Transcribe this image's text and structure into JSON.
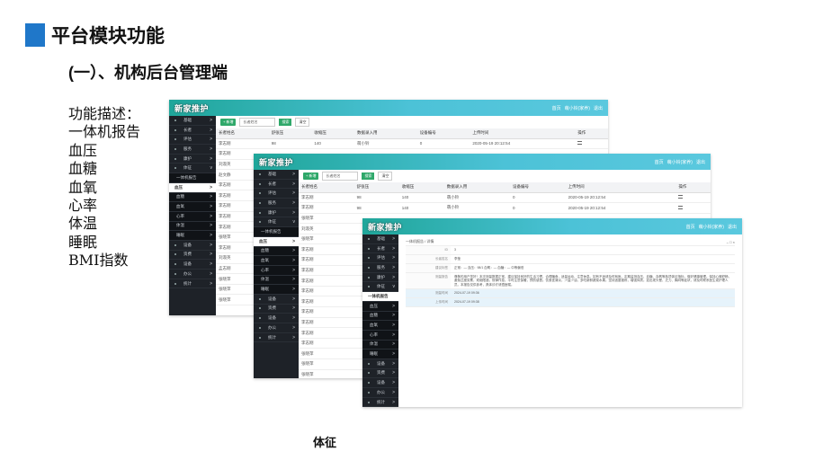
{
  "slide": {
    "title": "平台模块功能",
    "subtitle": "(一）、机构后台管理端",
    "desc_heading": "功能描述：",
    "desc_items": [
      "一体机报告",
      "血压",
      "血糖",
      "血氧",
      "心率",
      "体温",
      "睡眠",
      "BMI指数"
    ],
    "caption": "体征"
  },
  "app": {
    "brand": "新家推护",
    "top_right": [
      "首页",
      "萌小铃(家养)",
      "退出"
    ],
    "add_label": "+ 新增",
    "select_placeholder": "长者姓名",
    "search_label": "搜索",
    "clear_label": "清空",
    "columns": [
      "长者姓名",
      "舒张压",
      "收缩压",
      "数据录入用",
      "设备编号",
      "上传时间",
      "操作"
    ]
  },
  "win1": {
    "sidebar": [
      {
        "label": "基础",
        "arrow": ">"
      },
      {
        "label": "长者",
        "arrow": ">"
      },
      {
        "label": "评估",
        "arrow": ">"
      },
      {
        "label": "服务",
        "arrow": ">"
      },
      {
        "label": "康护",
        "arrow": ">"
      },
      {
        "label": "体征",
        "arrow": "v"
      },
      {
        "label": "一体机报告",
        "arrow": "",
        "sub": true
      },
      {
        "label": "血压",
        "arrow": ">",
        "light": true
      },
      {
        "label": "血糖",
        "arrow": ">",
        "sub": true
      },
      {
        "label": "血氧",
        "arrow": ">",
        "sub": true
      },
      {
        "label": "心率",
        "arrow": ">",
        "sub": true
      },
      {
        "label": "体温",
        "arrow": ">",
        "sub": true
      },
      {
        "label": "睡眠",
        "arrow": ">",
        "sub": true
      },
      {
        "label": "设备",
        "arrow": ">"
      },
      {
        "label": "资费",
        "arrow": ">"
      },
      {
        "label": "设备",
        "arrow": ">"
      },
      {
        "label": "办公",
        "arrow": ">"
      },
      {
        "label": "统计",
        "arrow": ">"
      }
    ],
    "rows": [
      [
        "李志刚",
        "98",
        "140",
        "萌小铃",
        "0",
        "2020-05-19 20:12:54",
        "icon"
      ],
      [
        "李志刚",
        "",
        "",
        "",
        "",
        "",
        ""
      ],
      [
        "刘淑英",
        "",
        "",
        "",
        "",
        "",
        ""
      ],
      [
        "赵文静",
        "",
        "",
        "",
        "",
        "",
        ""
      ],
      [
        "李志刚",
        "",
        "",
        "",
        "",
        "",
        ""
      ],
      [
        "李志刚",
        "",
        "",
        "",
        "",
        "",
        ""
      ],
      [
        "李志刚",
        "",
        "",
        "",
        "",
        "",
        ""
      ],
      [
        "李志刚",
        "",
        "",
        "",
        "",
        "",
        ""
      ],
      [
        "李志刚",
        "",
        "",
        "",
        "",
        "",
        ""
      ],
      [
        "张晓萍",
        "",
        "",
        "",
        "",
        "",
        ""
      ],
      [
        "李志刚",
        "",
        "",
        "",
        "",
        "",
        ""
      ],
      [
        "刘淑英",
        "",
        "",
        "",
        "",
        "",
        ""
      ],
      [
        "孟志刚",
        "",
        "",
        "",
        "",
        "",
        ""
      ],
      [
        "张晓萍",
        "",
        "",
        "",
        "",
        "",
        ""
      ],
      [
        "张晓萍",
        "",
        "",
        "",
        "",
        "",
        ""
      ],
      [
        "张晓萍",
        "",
        "",
        "",
        "",
        "",
        ""
      ]
    ]
  },
  "win2": {
    "sidebar": [
      {
        "label": "基础",
        "arrow": ">"
      },
      {
        "label": "长者",
        "arrow": ">"
      },
      {
        "label": "评估",
        "arrow": ">"
      },
      {
        "label": "服务",
        "arrow": ">"
      },
      {
        "label": "康护",
        "arrow": ">"
      },
      {
        "label": "体征",
        "arrow": "v"
      },
      {
        "label": "一体机报告",
        "arrow": "",
        "sub": true
      },
      {
        "label": "血压",
        "arrow": ">",
        "light": true
      },
      {
        "label": "血糖",
        "arrow": ">",
        "sub": true
      },
      {
        "label": "血氧",
        "arrow": ">",
        "sub": true
      },
      {
        "label": "心率",
        "arrow": ">",
        "sub": true
      },
      {
        "label": "体温",
        "arrow": ">",
        "sub": true
      },
      {
        "label": "睡眠",
        "arrow": ">",
        "sub": true
      },
      {
        "label": "设备",
        "arrow": ">"
      },
      {
        "label": "资费",
        "arrow": ">"
      },
      {
        "label": "设备",
        "arrow": ">"
      },
      {
        "label": "办公",
        "arrow": ">"
      },
      {
        "label": "统计",
        "arrow": ">"
      }
    ],
    "rows": [
      [
        "李志刚",
        "98",
        "140",
        "萌小铃",
        "0",
        "2020-05-19 20:12:54",
        "icon"
      ],
      [
        "李志刚",
        "98",
        "140",
        "萌小铃",
        "0",
        "2020-05-19 20:12:54",
        "icon"
      ],
      [
        "张晓萍",
        "",
        "",
        "",
        "",
        "",
        ""
      ],
      [
        "刘淑英",
        "",
        "",
        "",
        "",
        "",
        ""
      ],
      [
        "张晓萍",
        "",
        "",
        "",
        "",
        "",
        ""
      ],
      [
        "李志刚",
        "",
        "",
        "",
        "",
        "",
        ""
      ],
      [
        "李志刚",
        "",
        "",
        "",
        "",
        "",
        ""
      ],
      [
        "李志刚",
        "",
        "",
        "",
        "",
        "",
        ""
      ],
      [
        "李志刚",
        "",
        "",
        "",
        "",
        "",
        ""
      ],
      [
        "李志刚",
        "",
        "",
        "",
        "",
        "",
        ""
      ],
      [
        "李志刚",
        "",
        "",
        "",
        "",
        "",
        ""
      ],
      [
        "李志刚",
        "",
        "",
        "",
        "",
        "",
        ""
      ],
      [
        "李志刚",
        "",
        "",
        "",
        "",
        "",
        ""
      ],
      [
        "李志刚",
        "",
        "",
        "",
        "",
        "",
        ""
      ],
      [
        "李志刚",
        "",
        "",
        "",
        "",
        "",
        ""
      ],
      [
        "张晓萍",
        "",
        "",
        "",
        "",
        "",
        ""
      ],
      [
        "张晓萍",
        "",
        "",
        "",
        "",
        "",
        ""
      ],
      [
        "张晓萍",
        "",
        "",
        "",
        "",
        "",
        ""
      ]
    ]
  },
  "win3": {
    "sidebar": [
      {
        "label": "基础",
        "arrow": ">"
      },
      {
        "label": "长者",
        "arrow": ">"
      },
      {
        "label": "评估",
        "arrow": ">"
      },
      {
        "label": "服务",
        "arrow": ">"
      },
      {
        "label": "康护",
        "arrow": ">"
      },
      {
        "label": "体征",
        "arrow": "v"
      },
      {
        "label": "一体机报告",
        "arrow": "",
        "light": true
      },
      {
        "label": "血压",
        "arrow": ">",
        "sub": true
      },
      {
        "label": "血糖",
        "arrow": ">",
        "sub": true
      },
      {
        "label": "血氧",
        "arrow": ">",
        "sub": true
      },
      {
        "label": "心率",
        "arrow": ">",
        "sub": true
      },
      {
        "label": "体温",
        "arrow": ">",
        "sub": true
      },
      {
        "label": "睡眠",
        "arrow": ">",
        "sub": true
      },
      {
        "label": "设备",
        "arrow": ">"
      },
      {
        "label": "资费",
        "arrow": ">"
      },
      {
        "label": "设备",
        "arrow": ">"
      },
      {
        "label": "办公",
        "arrow": ">"
      },
      {
        "label": "统计",
        "arrow": ">"
      }
    ],
    "breadcrumb": "一体机报告 / 详情",
    "fields": [
      {
        "label": "ID",
        "value": "3"
      },
      {
        "label": "长者姓名",
        "value": "李莹"
      },
      {
        "label": "建议标签",
        "value": "正常：—  血压：98/1  血氧：—  血糖：— 中等偏低"
      },
      {
        "label": "测量报告",
        "value": "尊敬的用户您好！本次测量数据正常，建议保持良好的生活习惯，合理膳食，适量运动，注意休息。如有不适请及时就医。定期监测血压、血糖、血氧等各项体征指标，做好健康管理。保持心情舒畅，避免过度劳累，戒烟限酒，规律作息。平时注意保暖，预防感冒。饮食宜清淡，少盐少油，多吃新鲜蔬菜水果。坚持适度锻炼，增强体质。如出现头晕、乏力、胸闷等症状，请及时联系医生或护理人员。本报告仅供参考，具体诊疗请遵医嘱。",
        "blue": false
      },
      {
        "label": "测量时间",
        "value": "2024-07-19 09:36",
        "blue": true
      },
      {
        "label": "上传时间",
        "value": "2024-07-19 09:38",
        "blue": true
      }
    ]
  }
}
